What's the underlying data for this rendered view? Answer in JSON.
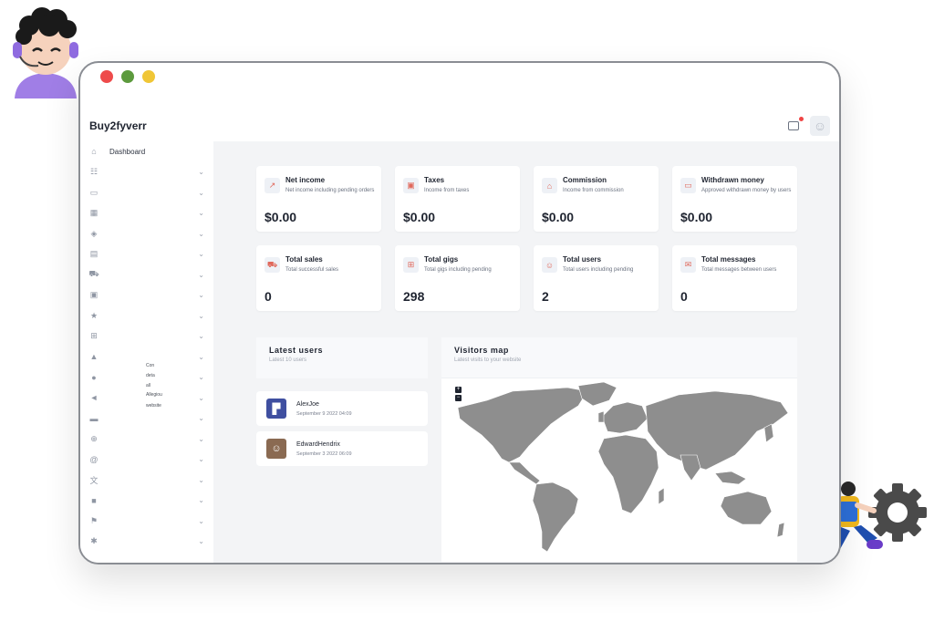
{
  "app": {
    "brand": "Buy2fyverr"
  },
  "window": {
    "dot_colors": [
      "#ee4b4b",
      "#5c9a3d",
      "#f0c636"
    ]
  },
  "header": {
    "notification_icon": "image-icon",
    "avatar_icon": "user-icon"
  },
  "sidebar": {
    "items": [
      {
        "icon": "home-icon",
        "glyph": "⌂",
        "label": "Dashboard",
        "chevron": false
      },
      {
        "icon": "users-icon",
        "glyph": "☷",
        "label": "",
        "chevron": true
      },
      {
        "icon": "card-icon",
        "glyph": "▭",
        "label": "",
        "chevron": true
      },
      {
        "icon": "layout-icon",
        "glyph": "▦",
        "label": "",
        "chevron": true
      },
      {
        "icon": "box-icon",
        "glyph": "◈",
        "label": "",
        "chevron": true
      },
      {
        "icon": "document-icon",
        "glyph": "▤",
        "label": "",
        "chevron": true
      },
      {
        "icon": "cart-icon",
        "glyph": "⛟",
        "label": "",
        "chevron": true
      },
      {
        "icon": "image-icon",
        "glyph": "▣",
        "label": "",
        "chevron": true
      },
      {
        "icon": "star-icon",
        "glyph": "★",
        "label": "",
        "chevron": true
      },
      {
        "icon": "grid-icon",
        "glyph": "⊞",
        "label": "",
        "chevron": true
      },
      {
        "icon": "warning-icon",
        "glyph": "▲",
        "label": "",
        "chevron": true
      },
      {
        "icon": "chat-icon",
        "glyph": "●",
        "label": "",
        "chevron": true
      },
      {
        "icon": "megaphone-icon",
        "glyph": "◄",
        "label": "",
        "chevron": true
      },
      {
        "icon": "folder-icon",
        "glyph": "▬",
        "label": "",
        "chevron": true
      },
      {
        "icon": "globe-icon",
        "glyph": "⊕",
        "label": "",
        "chevron": true
      },
      {
        "icon": "at-icon",
        "glyph": "@",
        "label": "",
        "chevron": true
      },
      {
        "icon": "translate-icon",
        "glyph": "文",
        "label": "",
        "chevron": true
      },
      {
        "icon": "truck-icon",
        "glyph": "■",
        "label": "",
        "chevron": true
      },
      {
        "icon": "flag-icon",
        "glyph": "⚑",
        "label": "",
        "chevron": true
      },
      {
        "icon": "puzzle-icon",
        "glyph": "✱",
        "label": "",
        "chevron": true
      }
    ],
    "fragments": [
      "Con",
      "deta",
      "all",
      "Allegiou",
      "website"
    ]
  },
  "stats": [
    {
      "icon": "trend-up-icon",
      "glyph": "↗",
      "title": "Net income",
      "subtitle": "Net income including pending orders",
      "value": "$0.00"
    },
    {
      "icon": "receipt-icon",
      "glyph": "▣",
      "title": "Taxes",
      "subtitle": "Income from taxes",
      "value": "$0.00"
    },
    {
      "icon": "gift-icon",
      "glyph": "⌂",
      "title": "Commission",
      "subtitle": "Income from commission",
      "value": "$0.00"
    },
    {
      "icon": "credit-card-icon",
      "glyph": "▭",
      "title": "Withdrawn money",
      "subtitle": "Approved withdrawn money by users",
      "value": "$0.00"
    },
    {
      "icon": "cart-icon",
      "glyph": "⛟",
      "title": "Total sales",
      "subtitle": "Total successful sales",
      "value": "0"
    },
    {
      "icon": "gigs-icon",
      "glyph": "⊞",
      "title": "Total gigs",
      "subtitle": "Total gigs including pending",
      "value": "298"
    },
    {
      "icon": "users-icon",
      "glyph": "☺",
      "title": "Total users",
      "subtitle": "Total users including pending",
      "value": "2"
    },
    {
      "icon": "mail-icon",
      "glyph": "✉",
      "title": "Total messages",
      "subtitle": "Total messages between users",
      "value": "0"
    }
  ],
  "latest_users": {
    "title": "Latest users",
    "subtitle": "Latest 10 users",
    "users": [
      {
        "name": "AlexJoe",
        "date": "September 9 2022 04:09",
        "avatar_color": "#3f4fa0",
        "avatar_icon": "logo-avatar-icon"
      },
      {
        "name": "EdwardHendrix",
        "date": "September 3 2022 06:09",
        "avatar_color": "#8a6a52",
        "avatar_icon": "photo-avatar-icon"
      }
    ]
  },
  "visitors_map": {
    "title": "Visitors map",
    "subtitle": "Latest visits to your website",
    "zoom_in": "+",
    "zoom_out": "−",
    "land_color": "#8e8e8e"
  },
  "colors": {
    "accent": "#e0685b",
    "background": "#f3f4f6"
  }
}
